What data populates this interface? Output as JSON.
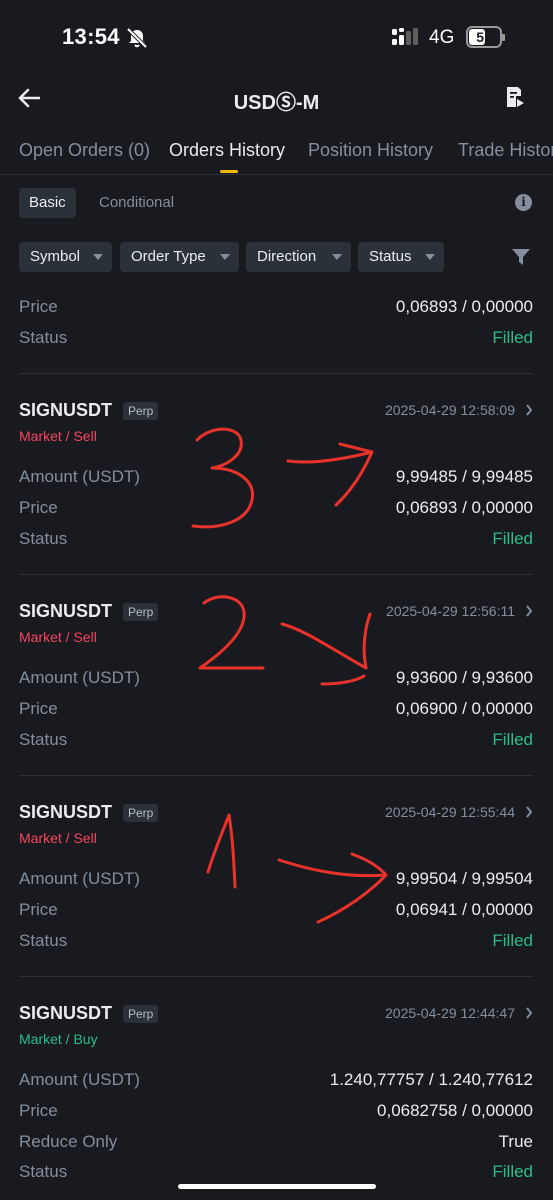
{
  "status_bar": {
    "time": "13:54",
    "network": "4G",
    "battery": "51"
  },
  "header": {
    "back_icon": "arrow-left-icon",
    "title": "USDⓈ-M",
    "history_icon": "document-icon"
  },
  "tabs": [
    "Open Orders (0)",
    "Orders History",
    "Position History",
    "Trade History"
  ],
  "active_tab": "Orders History",
  "subtabs": [
    "Basic",
    "Conditional"
  ],
  "filters": [
    "Symbol",
    "Order Type",
    "Direction",
    "Status"
  ],
  "accent_color": "#f0b90b",
  "sell_color": "#f6465d",
  "buy_color": "#2ebd85",
  "partial_order": {
    "price_label": "Price",
    "price": "0,06893 / 0,00000",
    "status_label": "Status",
    "status": "Filled"
  },
  "orders": [
    {
      "symbol": "SIGNUSDT",
      "badge": "Perp",
      "side": "Market / Sell",
      "timestamp": "2025-04-29 12:58:09",
      "amount_label": "Amount (USDT)",
      "amount": "9,99485 / 9,99485",
      "price_label": "Price",
      "price": "0,06893 / 0,00000",
      "status_label": "Status",
      "status": "Filled"
    },
    {
      "symbol": "SIGNUSDT",
      "badge": "Perp",
      "side": "Market / Sell",
      "timestamp": "2025-04-29 12:56:11",
      "amount_label": "Amount (USDT)",
      "amount": "9,93600 / 9,93600",
      "price_label": "Price",
      "price": "0,06900 / 0,00000",
      "status_label": "Status",
      "status": "Filled"
    },
    {
      "symbol": "SIGNUSDT",
      "badge": "Perp",
      "side": "Market / Sell",
      "timestamp": "2025-04-29 12:55:44",
      "amount_label": "Amount (USDT)",
      "amount": "9,99504 / 9,99504",
      "price_label": "Price",
      "price": "0,06941 / 0,00000",
      "status_label": "Status",
      "status": "Filled"
    },
    {
      "symbol": "SIGNUSDT",
      "badge": "Perp",
      "side": "Market / Buy",
      "timestamp": "2025-04-29 12:44:47",
      "amount_label": "Amount (USDT)",
      "amount": "1.240,77757 / 1.240,77612",
      "price_label": "Price",
      "price": "0,0682758 / 0,00000",
      "reduce_label": "Reduce Only",
      "reduce_only": "True",
      "status_label": "Status",
      "status": "Filled"
    }
  ],
  "annotations": {
    "color": "#e8322a",
    "digits": [
      "3",
      "2",
      "1"
    ]
  }
}
